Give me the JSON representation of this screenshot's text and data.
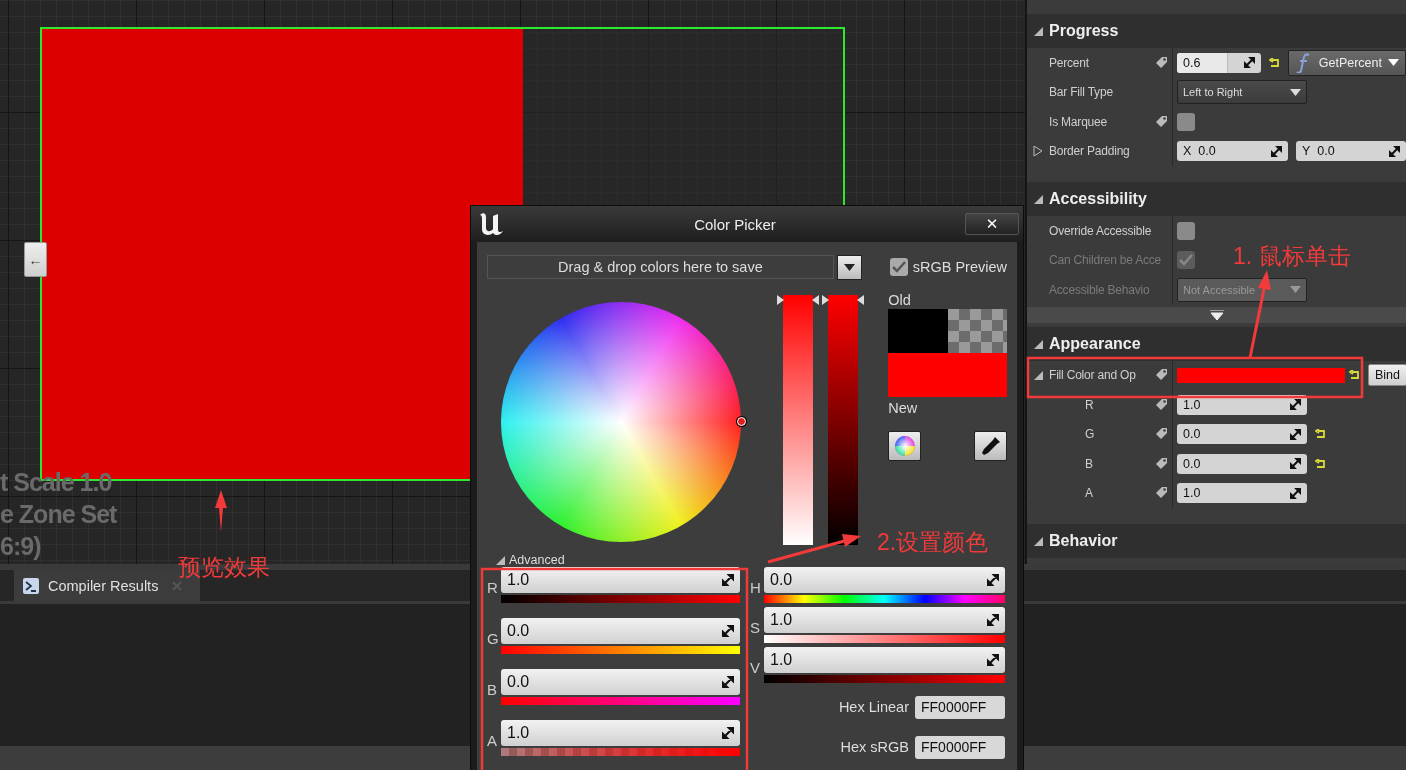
{
  "canvas": {
    "back_button": "←",
    "progress": {
      "level": 0.6,
      "color": "#dd0000"
    },
    "overlay_texts": [
      "t Scale 1.0",
      "e Zone Set",
      "6:9)"
    ]
  },
  "details": {
    "sections": [
      {
        "title": "Progress",
        "expanded": true,
        "rows": [
          {
            "kind": "number",
            "label": "Percent",
            "bindable": true,
            "value": "0.6",
            "level": 0.6,
            "resettable": true,
            "binding": "GetPercent"
          },
          {
            "kind": "dropdown",
            "label": "Bar Fill Type",
            "value": "Left to Right",
            "disabled": false
          },
          {
            "kind": "checkbox",
            "label": "Is Marquee",
            "bindable": true,
            "checked": false,
            "disabled": false
          },
          {
            "kind": "vector",
            "label": "Border Padding",
            "expanded": false,
            "fields": [
              {
                "axis": "X",
                "value": "0.0"
              },
              {
                "axis": "Y",
                "value": "0.0"
              }
            ]
          }
        ]
      },
      {
        "title": "Accessibility",
        "expanded": true,
        "advanced_toggle": true,
        "rows": [
          {
            "kind": "checkbox",
            "label": "Override Accessible",
            "checked": false,
            "disabled": false
          },
          {
            "kind": "checkbox",
            "label": "Can Children be Acce",
            "checked": true,
            "disabled": true
          },
          {
            "kind": "dropdown",
            "label": "Accessible Behavio",
            "value": "Not Accessible",
            "disabled": true
          }
        ]
      },
      {
        "title": "Appearance",
        "expanded": true,
        "rows": [
          {
            "kind": "color",
            "label": "Fill Color and Op",
            "bindable": true,
            "expanded": true,
            "color": "#ff0000",
            "resettable": true,
            "binding": "Bind",
            "children": [
              {
                "kind": "number",
                "label": "R",
                "bindable": true,
                "value": "1.0",
                "resettable": false
              },
              {
                "kind": "number",
                "label": "G",
                "bindable": true,
                "value": "0.0",
                "resettable": true
              },
              {
                "kind": "number",
                "label": "B",
                "bindable": true,
                "value": "0.0",
                "resettable": true
              },
              {
                "kind": "number",
                "label": "A",
                "bindable": true,
                "value": "1.0",
                "resettable": false
              }
            ]
          }
        ]
      },
      {
        "title": "Behavior",
        "expanded": true
      }
    ]
  },
  "bottom_panel": {
    "tabs": [
      {
        "label": "Compiler Results",
        "selected": true
      }
    ]
  },
  "color_picker": {
    "title": "Color Picker",
    "close": "✕",
    "save_area": "Drag & drop colors here to save",
    "srgb_preview": {
      "label": "sRGB Preview",
      "checked": true
    },
    "saturation_slider": {
      "level": 1
    },
    "value_slider": {
      "level": 1
    },
    "old_label": "Old",
    "new_label": "New",
    "advanced": {
      "label": "Advanced",
      "expanded": true
    },
    "rgba": [
      {
        "label": "R",
        "value": "1.0",
        "kind": "red"
      },
      {
        "label": "G",
        "value": "0.0",
        "kind": "green"
      },
      {
        "label": "B",
        "value": "0.0",
        "kind": "blue"
      },
      {
        "label": "A",
        "value": "1.0",
        "kind": "alpha"
      }
    ],
    "hsv": [
      {
        "label": "H",
        "value": "0.0",
        "kind": "hue"
      },
      {
        "label": "S",
        "value": "1.0",
        "kind": "saturation"
      },
      {
        "label": "V",
        "value": "1.0",
        "kind": "value"
      }
    ],
    "hex": [
      {
        "label": "Hex Linear",
        "value": "FF0000FF"
      },
      {
        "label": "Hex sRGB",
        "value": "FF0000FF"
      }
    ]
  },
  "annotations": [
    {
      "text": "1. 鼠标单击"
    },
    {
      "text": "2.设置颜色"
    },
    {
      "text": "预览效果"
    }
  ]
}
